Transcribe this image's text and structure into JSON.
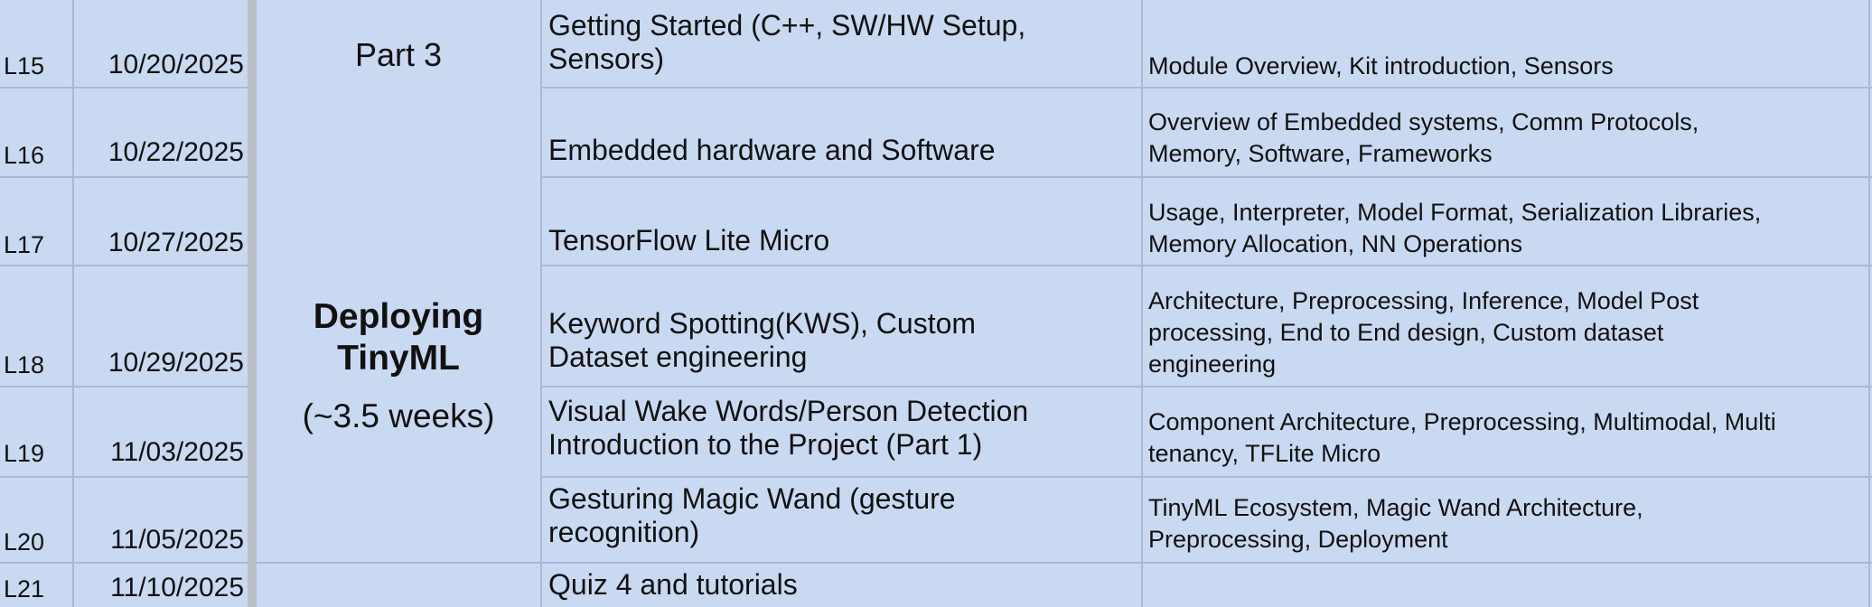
{
  "part_label": "Part 3",
  "section": {
    "title_line1": "Deploying",
    "title_line2": "TinyML",
    "duration": "(~3.5 weeks)"
  },
  "rows": [
    {
      "lecture": "L15",
      "date": "10/20/2025",
      "topic_lines": [
        "Getting Started (C++, SW/HW Setup,",
        "Sensors)"
      ],
      "content_lines": [
        "Module Overview, Kit introduction, Sensors"
      ]
    },
    {
      "lecture": "L16",
      "date": "10/22/2025",
      "topic_lines": [
        "Embedded hardware and Software"
      ],
      "content_lines": [
        "Overview of Embedded systems, Comm Protocols,",
        "Memory, Software, Frameworks"
      ]
    },
    {
      "lecture": "L17",
      "date": "10/27/2025",
      "topic_lines": [
        "TensorFlow Lite Micro"
      ],
      "content_lines": [
        "Usage, Interpreter, Model Format, Serialization Libraries,",
        "Memory Allocation, NN Operations"
      ]
    },
    {
      "lecture": "L18",
      "date": "10/29/2025",
      "topic_lines": [
        "Keyword Spotting(KWS), Custom",
        "Dataset engineering"
      ],
      "content_lines": [
        "Architecture, Preprocessing, Inference, Model Post",
        "processing, End to End design, Custom dataset",
        "engineering"
      ]
    },
    {
      "lecture": "L19",
      "date": "11/03/2025",
      "topic_lines": [
        "Visual Wake Words/Person Detection",
        "Introduction to the Project (Part 1)"
      ],
      "content_lines": [
        "Component Architecture, Preprocessing, Multimodal, Multi",
        "tenancy, TFLite Micro"
      ]
    },
    {
      "lecture": "L20",
      "date": "11/05/2025",
      "topic_lines": [
        "Gesturing Magic Wand (gesture",
        "recognition)"
      ],
      "content_lines": [
        "TinyML Ecosystem, Magic Wand Architecture,",
        "Preprocessing, Deployment"
      ]
    },
    {
      "lecture": "L21",
      "date": "11/10/2025",
      "topic_lines": [
        "Quiz 4 and tutorials"
      ],
      "content_lines": []
    }
  ]
}
